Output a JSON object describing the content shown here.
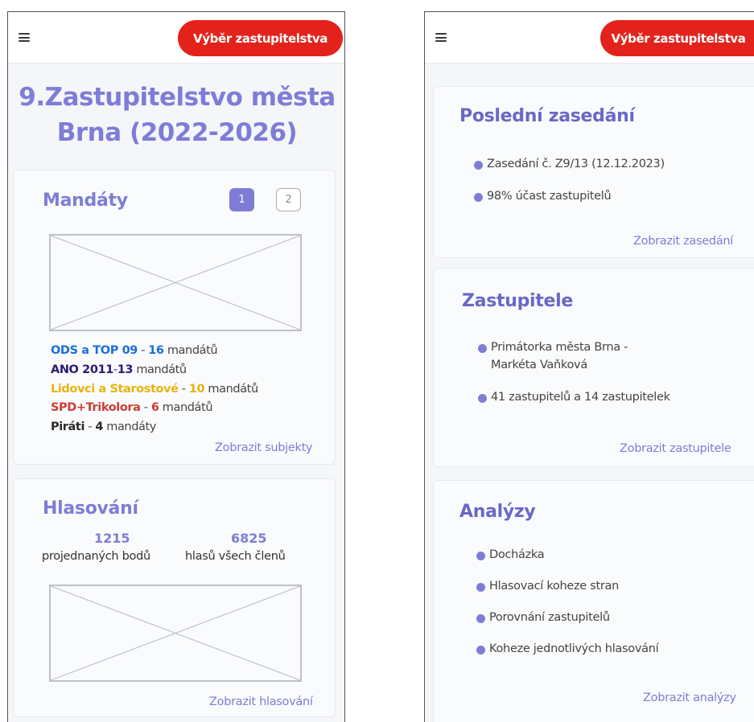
{
  "colors": {
    "accent": "#7e7dd6",
    "accent_dark": "#6a68c6",
    "brand_red": "#e3231b",
    "ods_blue": "#1a6fd8",
    "ano_purple": "#2b1a78",
    "lidovci_yellow": "#e8b30e",
    "spd_red": "#cc3d37",
    "pirati_dark": "#2a2a2a"
  },
  "header": {
    "menu_icon": "hamburger-icon",
    "select_label": "Výběr zastupitelstva"
  },
  "left": {
    "title_line1": "9.Zastupitelstvo města",
    "title_line2": "Brna (2022-2026)",
    "mandates": {
      "title": "Mandáty",
      "pages": [
        "1",
        "2"
      ],
      "active_page": "1",
      "parties": [
        {
          "name": "ODS a TOP 09",
          "sep": " - ",
          "count": "16",
          "unit": " mandátů",
          "color": "#1a6fd8"
        },
        {
          "name": "ANO 2011",
          "sep": "-",
          "count": "13",
          "unit": " mandátů",
          "color": "#2b1a78"
        },
        {
          "name": "Lidovci a Starostové",
          "sep": " - ",
          "count": "10",
          "unit": " mandátů",
          "color": "#e8b30e"
        },
        {
          "name": "SPD+Trikolora",
          "sep": " - ",
          "count": "6",
          "unit": " mandátů",
          "color": "#cc3d37"
        },
        {
          "name": "Piráti",
          "sep": " - ",
          "count": "4",
          "unit": " mandáty",
          "color": "#2a2a2a"
        }
      ],
      "link": "Zobrazit subjekty"
    },
    "voting": {
      "title": "Hlasování",
      "stat1_value": "1215",
      "stat1_label": "projednaných bodů",
      "stat2_value": "6825",
      "stat2_label": "hlasů všech členů",
      "link": "Zobrazit hlasování"
    }
  },
  "right": {
    "last_session": {
      "title": "Poslední zasedání",
      "items": [
        "Zasedání č. Z9/13 (12.12.2023)",
        "98% účast zastupitelů"
      ],
      "link": "Zobrazit zasedání"
    },
    "members": {
      "title": "Zastupitele",
      "items": [
        "Primátorka města Brna -",
        "Markéta Vaňková",
        "41 zastupitelů a  14 zastupitelek"
      ],
      "link": "Zobrazit zastupitele"
    },
    "analyses": {
      "title": "Analýzy",
      "items": [
        "Docházka",
        "Hlasovací koheze stran",
        "Porovnání zastupitelů",
        "Koheze jednotlivých hlasování"
      ],
      "link": "Zobrazit analýzy"
    }
  }
}
